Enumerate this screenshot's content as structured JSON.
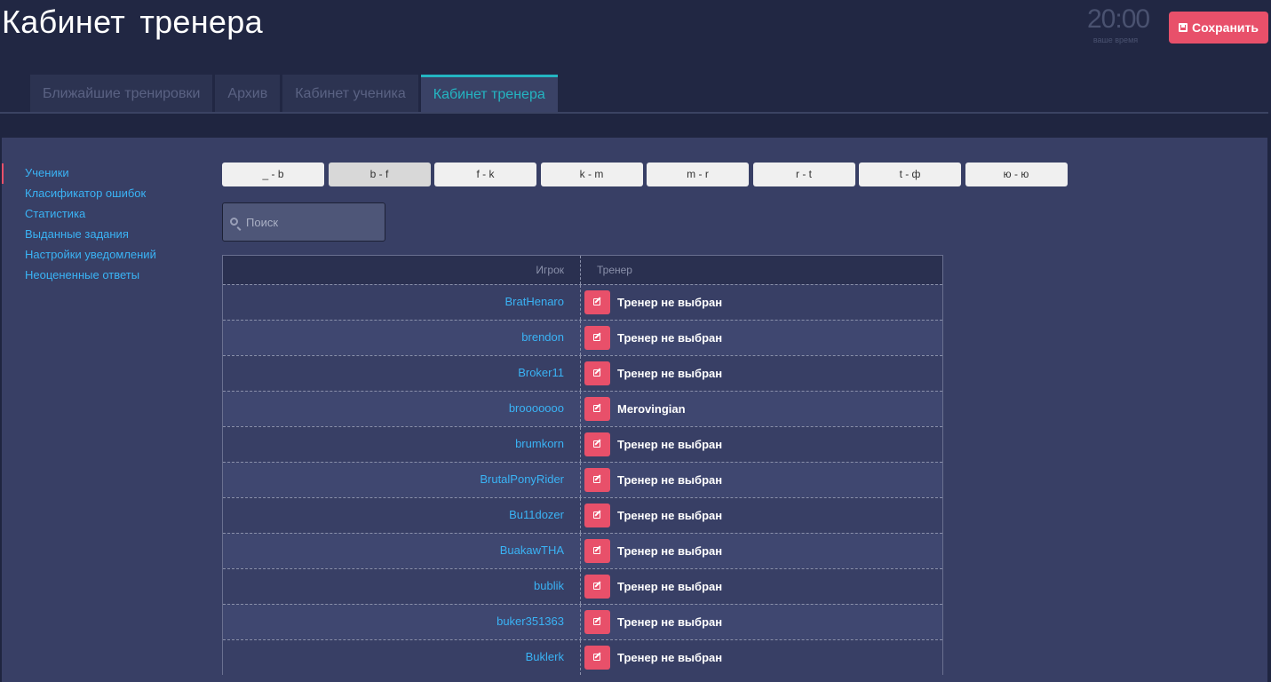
{
  "header": {
    "title": "Кабинет тренера",
    "clock_time": "20:00",
    "clock_label": "ваше время",
    "save_label": "Сохранить"
  },
  "tabs": [
    {
      "label": "Ближайшие тренировки"
    },
    {
      "label": "Архив"
    },
    {
      "label": "Кабинет ученика"
    },
    {
      "label": "Кабинет тренера"
    }
  ],
  "active_tab": 3,
  "sidebar": {
    "items": [
      {
        "label": "Ученики"
      },
      {
        "label": "Класификатор ошибок"
      },
      {
        "label": "Статистика"
      },
      {
        "label": "Выданные задания"
      },
      {
        "label": "Настройки уведомлений"
      },
      {
        "label": "Неоцененные ответы"
      }
    ]
  },
  "letters": [
    "_ - b",
    "b - f",
    "f - k",
    "k - m",
    "m - r",
    "r - t",
    "t - ф",
    "ю - ю"
  ],
  "active_letter": 1,
  "search": {
    "placeholder": "Поиск"
  },
  "table": {
    "headers": {
      "player": "Игрок",
      "trainer": "Тренер"
    },
    "rows": [
      {
        "player": "BratHenaro",
        "trainer": "Тренер не выбран"
      },
      {
        "player": "brendon",
        "trainer": "Тренер не выбран"
      },
      {
        "player": "Broker11",
        "trainer": "Тренер не выбран"
      },
      {
        "player": "brooooooo",
        "trainer": "Merovingian"
      },
      {
        "player": "brumkorn",
        "trainer": "Тренер не выбран"
      },
      {
        "player": "BrutalPonyRider",
        "trainer": "Тренер не выбран"
      },
      {
        "player": "Bu11dozer",
        "trainer": "Тренер не выбран"
      },
      {
        "player": "BuakawTHA",
        "trainer": "Тренер не выбран"
      },
      {
        "player": "bublik",
        "trainer": "Тренер не выбран"
      },
      {
        "player": "buker351363",
        "trainer": "Тренер не выбран"
      },
      {
        "player": "Buklerk",
        "trainer": "Тренер не выбран"
      }
    ]
  },
  "colors": {
    "accent": "#e8506a",
    "link": "#3ab3f5",
    "active_tab": "#24b5c2"
  },
  "icons": {
    "save": "floppy-icon",
    "search": "search-icon",
    "edit": "edit-icon"
  }
}
